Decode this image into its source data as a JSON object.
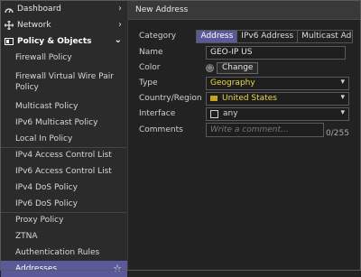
{
  "sidebar": {
    "top_items": [
      {
        "label": "Dashboard",
        "icon": "dashboard-icon"
      },
      {
        "label": "Network",
        "icon": "network-icon"
      }
    ],
    "section": {
      "label": "Policy & Objects",
      "icon": "policy-icon"
    },
    "items": [
      {
        "label": "Firewall Policy"
      },
      {
        "label": "Firewall Virtual Wire Pair Policy"
      },
      {
        "label": "Multicast Policy"
      },
      {
        "label": "IPv6 Multicast Policy"
      },
      {
        "label": "Local In Policy"
      },
      {
        "label": "IPv4 Access Control List"
      },
      {
        "label": "IPv6 Access Control List"
      },
      {
        "label": "IPv4 DoS Policy"
      },
      {
        "label": "IPv6 DoS Policy"
      },
      {
        "label": "Proxy Policy"
      },
      {
        "label": "ZTNA"
      },
      {
        "label": "Authentication Rules"
      },
      {
        "label": "Addresses"
      }
    ]
  },
  "header": {
    "title": "New Address"
  },
  "form": {
    "category": {
      "label": "Category",
      "options": [
        "Address",
        "IPv6 Address",
        "Multicast Address"
      ],
      "selected": "Address"
    },
    "name": {
      "label": "Name",
      "value": "GEO-IP US"
    },
    "color": {
      "label": "Color",
      "button": "Change"
    },
    "type": {
      "label": "Type",
      "value": "Geography"
    },
    "country": {
      "label": "Country/Region",
      "value": "United States"
    },
    "interface": {
      "label": "Interface",
      "value": "any"
    },
    "comments": {
      "label": "Comments",
      "placeholder": "Write a comment...",
      "counter": "0/255"
    }
  },
  "colors": {
    "accent": "#5a5a9a",
    "highlight_text": "#ecd84a"
  }
}
